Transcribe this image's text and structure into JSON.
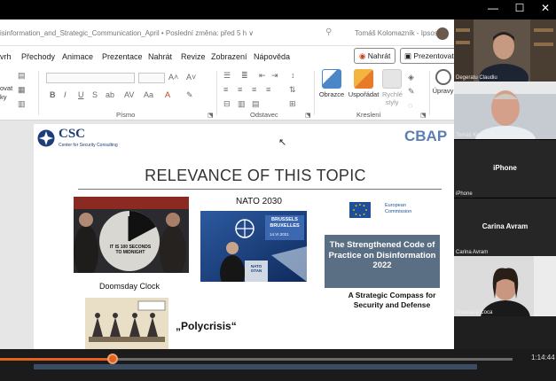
{
  "window": {
    "controls": {
      "minimize": "—",
      "maximize": "☐",
      "close": "✕"
    }
  },
  "powerpoint": {
    "doc_title": "isinformation_and_Strategic_Communication_April • Poslední změna: před 5 h ∨",
    "user_name": "Tomáš Kolomazník - Ipsos",
    "menu": [
      "vrh",
      "Přechody",
      "Animace",
      "Prezentace",
      "Nahrát",
      "Revize",
      "Zobrazení",
      "Nápověda"
    ],
    "record_button": "Nahrát",
    "present_button": "Prezentovat v",
    "ribbon": {
      "left_labels": [
        "ovat",
        "ky"
      ],
      "group_font": "Písmo",
      "group_paragraph": "Odstavec",
      "group_drawing": "Kreslení",
      "font_buttons": [
        "B",
        "I",
        "U",
        "S",
        "ab",
        "AV"
      ],
      "big_buttons": [
        "Obrazce",
        "Uspořádat",
        "Rychlé styly",
        "Úpravy"
      ]
    }
  },
  "slide": {
    "csc_name": "CSC",
    "csc_sub": "Center for Security Consulting",
    "cbap": "CBAP",
    "title": "RELEVANCE OF THIS TOPIC",
    "nato_title": "NATO 2030",
    "doomsday_caption": "Doomsday Clock",
    "clock_text": "IT IS 100 SECONDS TO MIDNIGHT",
    "brussels_text": "BRUSSELS BRUXELLES",
    "brussels_date": "14.VI.2021",
    "nato_podium": "NATO OTAN",
    "eu_logo_text": "European Commission",
    "code_of_practice": "The Strengthened Code of Practice on Disinformation 2022",
    "compass": "A Strategic Compass for Security and Defense",
    "polycrisis": "„Polycrisis“"
  },
  "participants": [
    {
      "name": "Degeratu Claudiu",
      "kind": "video"
    },
    {
      "name": "Tomáš Kolomazník",
      "kind": "video"
    },
    {
      "name": "iPhone",
      "kind": "label"
    },
    {
      "name": "Carina Avram",
      "kind": "label"
    },
    {
      "name": "Anamaria Coca",
      "kind": "video"
    }
  ],
  "player": {
    "elapsed_time": "1:14:44",
    "progress_fraction": 0.22,
    "colors": {
      "accent": "#e5611e"
    }
  }
}
